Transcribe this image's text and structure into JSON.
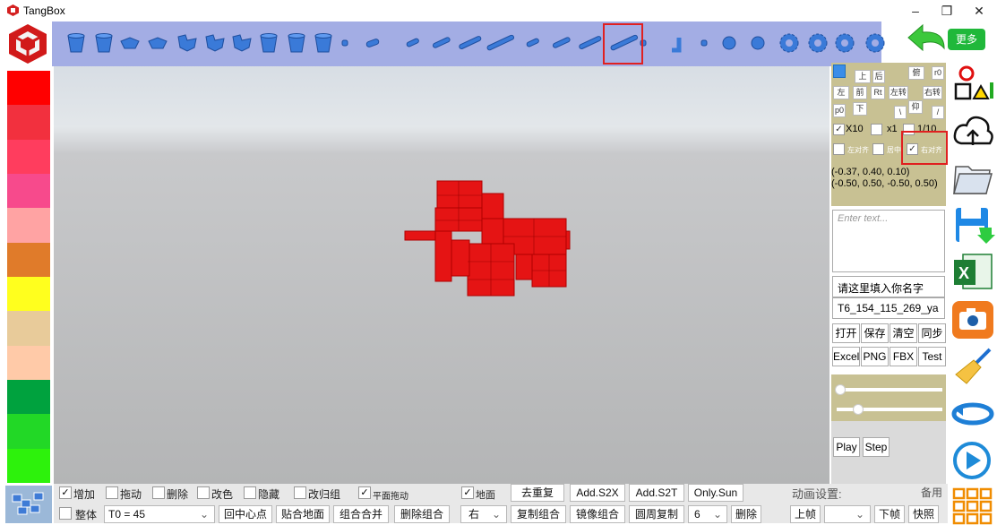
{
  "window": {
    "title": "TangBox",
    "minimize": "–",
    "maximize": "❐",
    "close": "✕"
  },
  "palette": {
    "colors": [
      "#ff0000",
      "#f2303e",
      "#ff3d5e",
      "#f74a8c",
      "#ffa3a3",
      "#e07b2a",
      "#ffff1e",
      "#e8cb9a",
      "#ffcaa8",
      "#00a23e",
      "#22d826",
      "#2df20c"
    ]
  },
  "top_right": {
    "more_label": "更多"
  },
  "panel": {
    "row1": [
      "上",
      "后",
      "俯",
      "r0"
    ],
    "row2": [
      "左",
      "前",
      "Rt",
      "左转",
      "右转"
    ],
    "row3": [
      "p0",
      "下",
      "\\",
      "仰",
      "/"
    ],
    "x10": "X10",
    "x1": "x1",
    "tenth": "1/10",
    "align_left": "左对齐",
    "align_center": "居中",
    "align_right": "右对齐",
    "coord1": "(-0.37, 0.40, 0.10)",
    "coord2": "(-0.50, 0.50, -0.50, 0.50)"
  },
  "textarea": {
    "placeholder": "Enter text..."
  },
  "name_field": {
    "value": "请这里填入你名字"
  },
  "file_field": {
    "value": "T6_154_115_269_ya"
  },
  "file_buttons": [
    "打开",
    "保存",
    "清空",
    "同步"
  ],
  "export_buttons": [
    "Excel",
    "PNG",
    "FBX",
    "Test"
  ],
  "play": {
    "play": "Play",
    "step": "Step"
  },
  "bottom": {
    "row1": {
      "add": "增加",
      "drag": "拖动",
      "delete": "删除",
      "recolor": "改色",
      "hide": "隐藏",
      "regroup": "改归组",
      "plane_drag": "平面拖动",
      "ground": "地面",
      "dedupe": "去重复",
      "add_s2x": "Add.S2X",
      "add_s2t": "Add.S2T",
      "only_sun": "Only.Sun",
      "anim_settings": "动画设置:",
      "spare": "备用"
    },
    "row2": {
      "whole": "整体",
      "t0": "T0 = 45",
      "center": "回中心点",
      "stick_ground": "贴合地面",
      "merge": "组合合并",
      "delete_group": "删除组合",
      "direction": "右",
      "copy_group": "复制组合",
      "mirror_group": "镜像组合",
      "circle_copy": "圆周复制",
      "count": "6",
      "remove": "删除",
      "prev_frame": "上帧",
      "next_frame": "下帧",
      "snapshot": "快照"
    }
  }
}
